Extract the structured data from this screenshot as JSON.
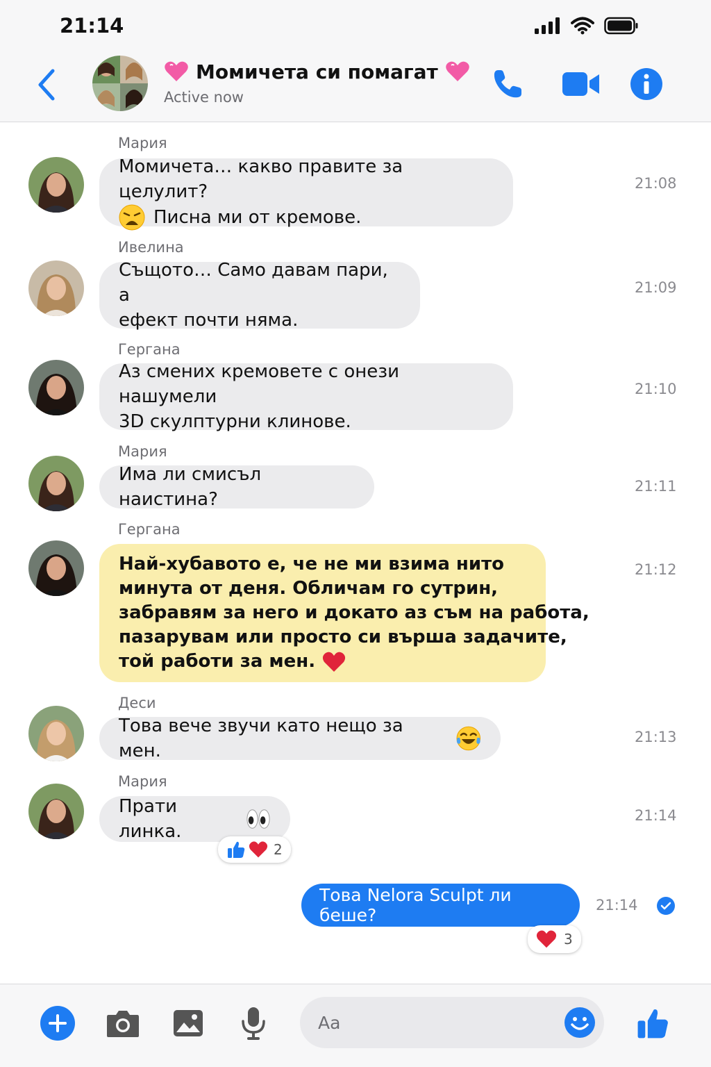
{
  "status_bar": {
    "time": "21:14"
  },
  "header": {
    "title": "Момичета си помагат",
    "subtitle": "Active now",
    "title_emoji_left": "heart-emoji",
    "title_emoji_right": "heart-emoji"
  },
  "messages": [
    {
      "sender": "Мария",
      "lines": [
        "Момичета… какво правите за целулит?",
        "Писна ми от кремове."
      ],
      "time": "21:08",
      "emoji": "weary-face"
    },
    {
      "sender": "Ивелина",
      "lines": [
        "Същото… Само давам пари, а",
        "ефект почти няма."
      ],
      "time": "21:09"
    },
    {
      "sender": "Гергана",
      "lines": [
        "Аз смених кремовете с онези нашумели",
        "3D скулптурни клинове."
      ],
      "time": "21:10"
    },
    {
      "sender": "Мария",
      "lines": [
        "Има ли смисъл наистина?"
      ],
      "time": "21:11"
    },
    {
      "sender": "Гергана",
      "lines": [
        "Най-хубавото е, че не ми взима нито",
        "минута от деня. Обличам го сутрин,",
        "забравям за него и докато аз съм на работа,",
        "пазарувам или просто си върша задачите,",
        "той работи за мен."
      ],
      "time": "21:12",
      "highlighted": true,
      "emoji": "red-heart"
    },
    {
      "sender": "Деси",
      "lines": [
        "Това вече звучи като нещо за мен."
      ],
      "time": "21:13",
      "emoji": "tears-of-joy"
    },
    {
      "sender": "Мария",
      "lines": [
        "Прати линка."
      ],
      "time": "21:14",
      "emoji": "eyes",
      "reactions": {
        "count": "2"
      }
    }
  ],
  "outgoing": {
    "text": "Това Nelora Sculpt ли беше?",
    "time": "21:14",
    "reactions": {
      "count": "3"
    },
    "status": "seen-check"
  },
  "composer": {
    "placeholder": "Aa"
  },
  "colors": {
    "accent": "#1e7cf2",
    "bubble": "#ebebed",
    "highlight": "#faeeae",
    "heart": "#e0245e"
  }
}
